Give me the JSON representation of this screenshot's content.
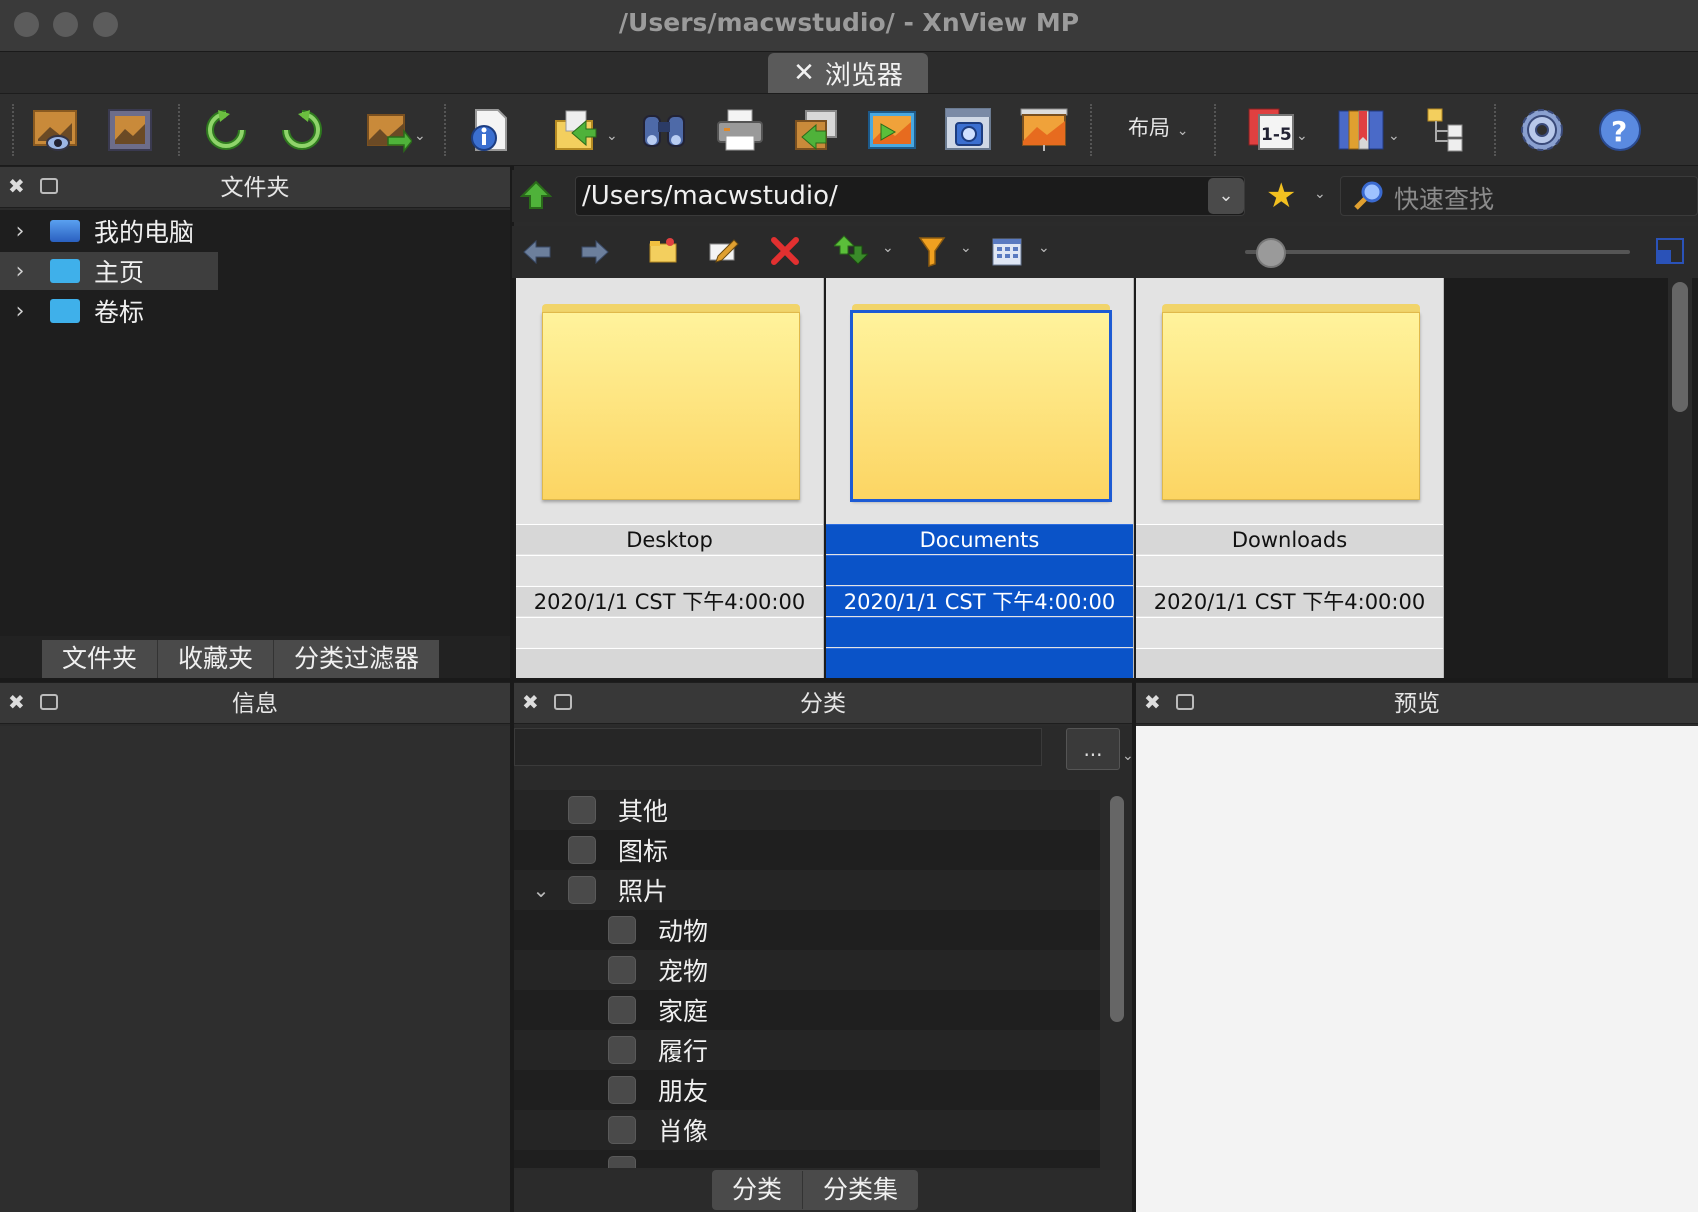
{
  "window": {
    "title": "/Users/macwstudio/ - XnView MP"
  },
  "tabs": [
    {
      "label": "浏览器"
    }
  ],
  "toolbar": {
    "layout_label": "布局",
    "items": [
      "view-icon",
      "fullscreen-icon",
      "rotate-left-icon",
      "rotate-right-icon",
      "convert-icon",
      "info-icon",
      "export-icon",
      "find-icon",
      "print-icon",
      "move-icon",
      "slideshow-icon",
      "capture-icon",
      "wallpaper-icon",
      "rating-icon",
      "bookmark-icon",
      "compare-icon",
      "settings-icon",
      "help-icon"
    ]
  },
  "folders_panel": {
    "title": "文件夹",
    "tree": [
      {
        "label": "我的电脑",
        "icon": "computer-icon"
      },
      {
        "label": "主页",
        "icon": "home-folder-icon",
        "selected": true
      },
      {
        "label": "卷标",
        "icon": "volume-folder-icon"
      }
    ],
    "tabs": [
      "文件夹",
      "收藏夹",
      "分类过滤器"
    ]
  },
  "path_bar": {
    "path": "/Users/macwstudio/",
    "search_placeholder": "快速查找"
  },
  "files": [
    {
      "name": "Desktop",
      "date": "2020/1/1 CST 下午4:00:00",
      "selected": false
    },
    {
      "name": "Documents",
      "date": "2020/1/1 CST 下午4:00:00",
      "selected": true
    },
    {
      "name": "Downloads",
      "date": "2020/1/1 CST 下午4:00:00",
      "selected": false
    }
  ],
  "info_panel": {
    "title": "信息"
  },
  "category_panel": {
    "title": "分类",
    "more_label": "...",
    "items": [
      {
        "label": "其他",
        "level": 0
      },
      {
        "label": "图标",
        "level": 0
      },
      {
        "label": "照片",
        "level": 0,
        "expanded": true
      },
      {
        "label": "动物",
        "level": 1
      },
      {
        "label": "宠物",
        "level": 1
      },
      {
        "label": "家庭",
        "level": 1
      },
      {
        "label": "履行",
        "level": 1
      },
      {
        "label": "朋友",
        "level": 1
      },
      {
        "label": "肖像",
        "level": 1
      }
    ],
    "tabs": [
      "分类",
      "分类集"
    ]
  },
  "preview_panel": {
    "title": "预览"
  },
  "colors": {
    "selection": "#0a53c8",
    "folder_yellow": "#fcd563"
  }
}
